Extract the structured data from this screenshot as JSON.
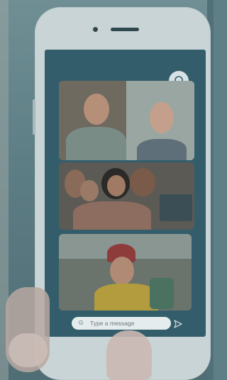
{
  "composer": {
    "placeholder": "Type a message"
  },
  "colors": {
    "screen_bg": "#335d6b",
    "phone_body": "#c9d4d6",
    "composer_bg": "#e4ecee"
  },
  "icons": {
    "support": "headset-icon",
    "composer_left": "emoji-icon",
    "send": "send-icon"
  },
  "video_tiles": [
    {
      "name": "group-call-tile-1"
    },
    {
      "name": "group-call-tile-2"
    },
    {
      "name": "group-call-tile-3"
    }
  ]
}
